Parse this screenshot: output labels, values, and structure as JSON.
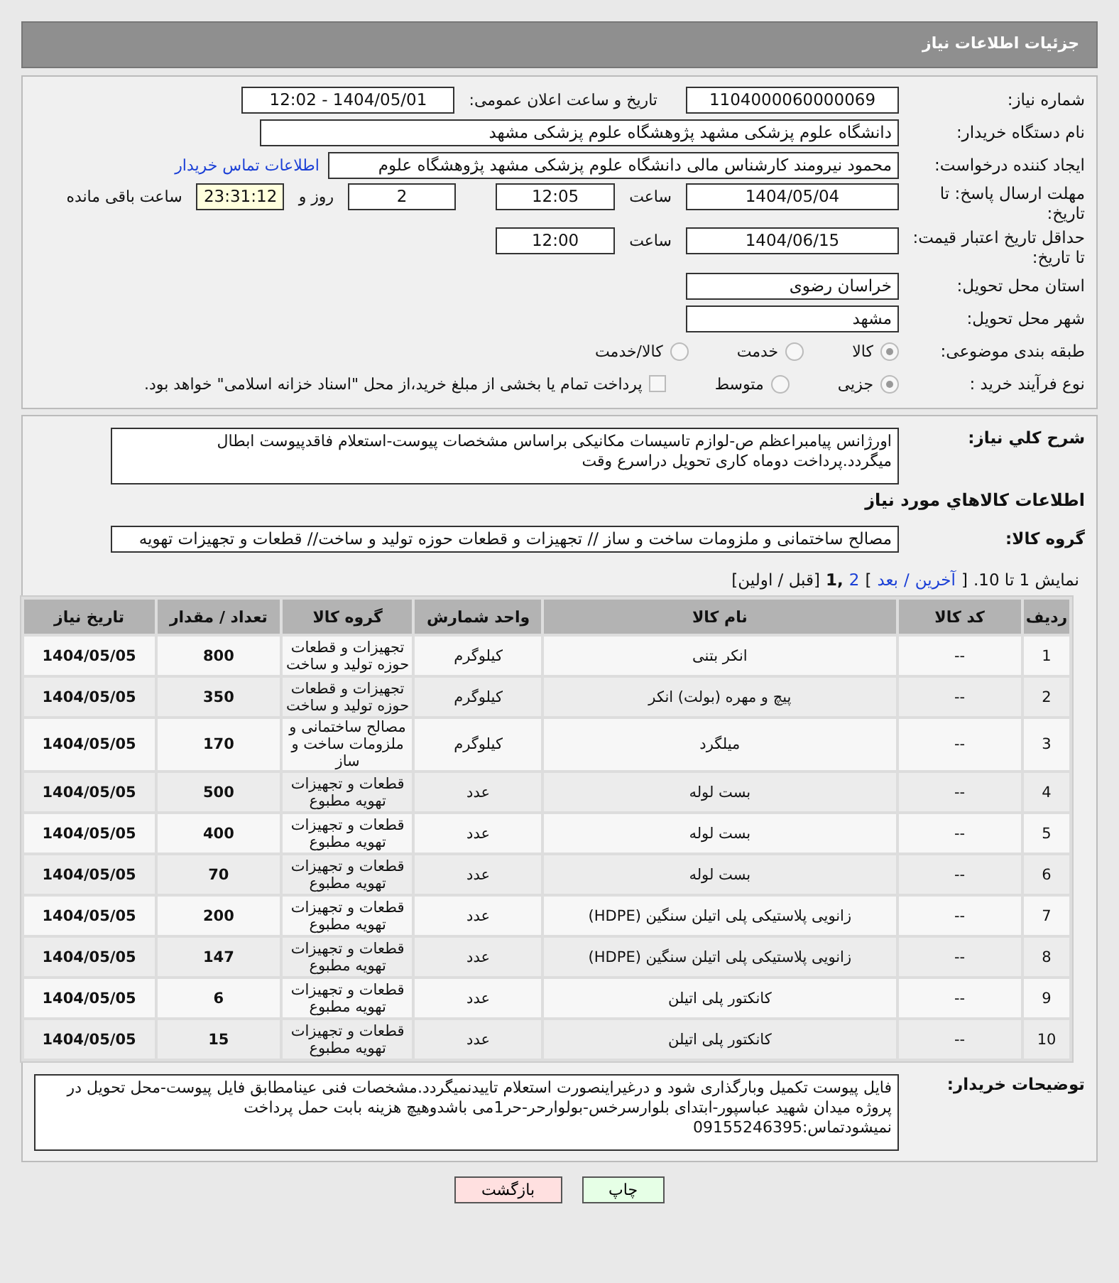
{
  "header": {
    "title": "جزئیات اطلاعات نیاز"
  },
  "form": {
    "need_number": {
      "label": "شماره نیاز:",
      "value": "1104000060000069"
    },
    "announce": {
      "label": "تاریخ و ساعت اعلان عمومی:",
      "value": "1404/05/01 - 12:02"
    },
    "buyer_org": {
      "label": "نام دستگاه خریدار:",
      "value": "دانشگاه علوم پزشکی مشهد   پژوهشگاه علوم پزشکی مشهد"
    },
    "requester": {
      "label": "ایجاد کننده درخواست:",
      "value": "محمود نیرومند کارشناس مالی دانشگاه علوم پزشکی مشهد   پژوهشگاه علوم",
      "link": "اطلاعات تماس خریدار"
    },
    "deadline": {
      "label": "مهلت ارسال پاسخ: تا تاریخ:",
      "date": "1404/05/04",
      "time_label": "ساعت",
      "time": "12:05",
      "days": "2",
      "days_label": "روز و",
      "remaining": "23:31:12",
      "remaining_label": "ساعت باقی مانده"
    },
    "validity": {
      "label": "حداقل تاریخ اعتبار قیمت: تا تاریخ:",
      "date": "1404/06/15",
      "time_label": "ساعت",
      "time": "12:00"
    },
    "province": {
      "label": "استان محل تحویل:",
      "value": "خراسان رضوی"
    },
    "city": {
      "label": "شهر محل تحویل:",
      "value": "مشهد"
    },
    "category": {
      "label": "طبقه بندی موضوعی:",
      "options": [
        {
          "label": "کالا",
          "selected": true
        },
        {
          "label": "خدمت",
          "selected": false
        },
        {
          "label": "کالا/خدمت",
          "selected": false
        }
      ]
    },
    "process": {
      "label": "نوع فرآیند خرید :",
      "options": [
        {
          "label": "جزیی",
          "selected": true
        },
        {
          "label": "متوسط",
          "selected": false
        }
      ],
      "payment": {
        "label": "پرداخت تمام یا بخشی از مبلغ خرید،از محل \"اسناد خزانه اسلامی\" خواهد بود.",
        "checked": false
      }
    }
  },
  "description": {
    "label": "شرح کلي نیاز:",
    "value": "اورژانس پیامبراعظم ص-لوازم تاسیسات مکانیکی براساس مشخصات پیوست-استعلام فاقدپیوست ابطال میگردد.پرداخت دوماه کاری تحویل دراسرع وقت"
  },
  "goods": {
    "title": "اطلاعات کالاهاي مورد نیاز",
    "group_label": "گروه کالا:",
    "group_value": "مصالح ساختمانی و ملزومات ساخت و ساز // تجهیزات و قطعات حوزه تولید و ساخت//  قطعات و تجهیزات تهویه",
    "pager": [
      {
        "text": "نمایش 1 تا 10.",
        "kind": "text"
      },
      {
        "text": "[",
        "kind": "text"
      },
      {
        "text": "آخرین",
        "kind": "link"
      },
      {
        "text": "/",
        "kind": "link"
      },
      {
        "text": "بعد",
        "kind": "link"
      },
      {
        "text": "]",
        "kind": "text"
      },
      {
        "text": "2",
        "kind": "link"
      },
      {
        "text": ",1",
        "kind": "current"
      },
      {
        "text": "[قبل / اولین]",
        "kind": "text"
      }
    ]
  },
  "table": {
    "columns": [
      "ردیف",
      "کد کالا",
      "نام کالا",
      "واحد شمارش",
      "گروه کالا",
      "تعداد / مقدار",
      "تاریخ نیاز"
    ],
    "rows": [
      [
        "1",
        "--",
        "انکر بتنی",
        "کیلوگرم",
        "تجهیزات و قطعات حوزه تولید و ساخت",
        "800",
        "1404/05/05"
      ],
      [
        "2",
        "--",
        "پیچ و مهره (بولت) انکر",
        "کیلوگرم",
        "تجهیزات و قطعات حوزه تولید و ساخت",
        "350",
        "1404/05/05"
      ],
      [
        "3",
        "--",
        "میلگرد",
        "کیلوگرم",
        "مصالح ساختمانی و ملزومات ساخت و ساز",
        "170",
        "1404/05/05"
      ],
      [
        "4",
        "--",
        "بست لوله",
        "عدد",
        "قطعات و تجهیزات تهویه مطبوع",
        "500",
        "1404/05/05"
      ],
      [
        "5",
        "--",
        "بست لوله",
        "عدد",
        "قطعات و تجهیزات تهویه مطبوع",
        "400",
        "1404/05/05"
      ],
      [
        "6",
        "--",
        "بست لوله",
        "عدد",
        "قطعات و تجهیزات تهویه مطبوع",
        "70",
        "1404/05/05"
      ],
      [
        "7",
        "--",
        "زانویی پلاستیکی پلی اتیلن سنگین (HDPE)",
        "عدد",
        "قطعات و تجهیزات تهویه مطبوع",
        "200",
        "1404/05/05"
      ],
      [
        "8",
        "--",
        "زانویی پلاستیکی پلی اتیلن سنگین (HDPE)",
        "عدد",
        "قطعات و تجهیزات تهویه مطبوع",
        "147",
        "1404/05/05"
      ],
      [
        "9",
        "--",
        "کانکتور پلی اتیلن",
        "عدد",
        "قطعات و تجهیزات تهویه مطبوع",
        "6",
        "1404/05/05"
      ],
      [
        "10",
        "--",
        "کانکتور پلی اتیلن",
        "عدد",
        "قطعات و تجهیزات تهویه مطبوع",
        "15",
        "1404/05/05"
      ]
    ]
  },
  "notes": {
    "label": "توضیحات خریدار:",
    "value": "فایل پیوست تکمیل وبارگذاری شود و درغیراینصورت استعلام تاییدنمیگردد.مشخصات فنی عینامطابق فایل پیوست-محل تحویل در پروژه میدان شهید عباسپور-ابتدای بلوارسرخس-بولوارحر-حر1می باشدوهیچ هزینه بابت حمل  پرداخت نمیشودتماس:09155246395"
  },
  "buttons": [
    {
      "label": "چاپ",
      "kind": "print"
    },
    {
      "label": "بازگشت",
      "kind": "back"
    }
  ]
}
